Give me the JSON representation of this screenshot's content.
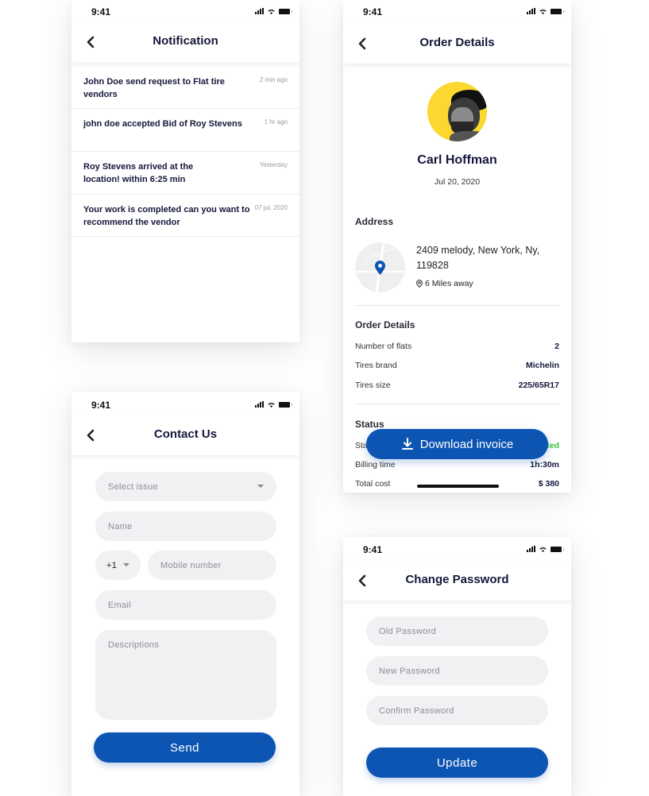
{
  "status_bar": {
    "time": "9:41"
  },
  "notification_screen": {
    "title": "Notification",
    "items": [
      {
        "message": "John Doe  send request to Flat tire vendors",
        "time": "2 min ago"
      },
      {
        "message": "john doe accepted Bid of Roy Stevens",
        "time": "1 hr ago"
      },
      {
        "message": "Roy Stevens arrived at the location! within 6:25 min",
        "time": "Yesterday"
      },
      {
        "message": "Your work is completed can you want to recommend the vendor",
        "time": "07 jul, 2020"
      }
    ]
  },
  "order_screen": {
    "title": "Order Details",
    "customer_name": "Carl Hoffman",
    "date": "Jul 20, 2020",
    "address_label": "Address",
    "address": "2409 melody, New York, Ny, 119828",
    "distance": "6 Miles away",
    "order_details_label": "Order Details",
    "order_details": [
      {
        "label": "Number of flats",
        "value": "2"
      },
      {
        "label": "Tires brand",
        "value": "Michelin"
      },
      {
        "label": "Tires size",
        "value": "225/65R17"
      }
    ],
    "status_label": "Status",
    "status_rows": [
      {
        "label": "Status",
        "value": "Completed"
      },
      {
        "label": "Billing time",
        "value": "1h:30m"
      },
      {
        "label": "Total cost",
        "value": "$ 380"
      }
    ],
    "download_button": "Download invoice",
    "colors": {
      "accent": "#0d55b3",
      "status_green": "#3cc13b",
      "avatar_bg": "#fbd730"
    }
  },
  "contact_screen": {
    "title": "Contact Us",
    "select_issue_placeholder": "Select issue",
    "name_placeholder": "Name",
    "country_code": "+1",
    "mobile_placeholder": "Mobile number",
    "email_placeholder": "Email",
    "descriptions_placeholder": "Descriptions",
    "send_button": "Send"
  },
  "password_screen": {
    "title": "Change Password",
    "old_password_placeholder": "Old Password",
    "new_password_placeholder": "New Password",
    "confirm_password_placeholder": "Confirm Password",
    "update_button": "Update"
  }
}
